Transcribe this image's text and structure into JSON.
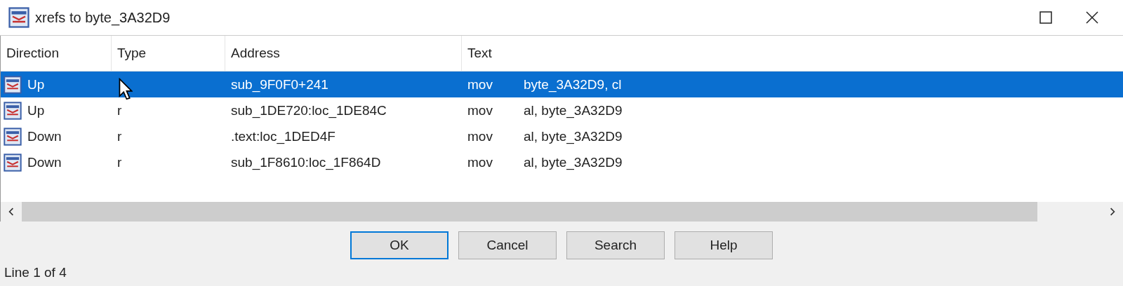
{
  "window": {
    "title": "xrefs to byte_3A32D9"
  },
  "table": {
    "columns": [
      "Direction",
      "Type",
      "Address",
      "Text"
    ],
    "rows": [
      {
        "direction": "Up",
        "address": "sub_9F0F0+241",
        "mnemonic": "mov",
        "operands": "byte_3A32D9, cl",
        "selected": true
      },
      {
        "direction": "Up",
        "type": "r",
        "address": "sub_1DE720:loc_1DE84C",
        "mnemonic": "mov",
        "operands": "al, byte_3A32D9",
        "selected": false
      },
      {
        "direction": "Down",
        "type": "r",
        "address": ".text:loc_1DED4F",
        "mnemonic": "mov",
        "operands": "al, byte_3A32D9",
        "selected": false
      },
      {
        "direction": "Down",
        "type": "r",
        "address": "sub_1F8610:loc_1F864D",
        "mnemonic": "mov",
        "operands": "al, byte_3A32D9",
        "selected": false
      }
    ]
  },
  "buttons": [
    {
      "label": "OK",
      "default": true
    },
    {
      "label": "Cancel",
      "default": false
    },
    {
      "label": "Search",
      "default": false
    },
    {
      "label": "Help",
      "default": false
    }
  ],
  "status_bar": "Line 1 of 4"
}
